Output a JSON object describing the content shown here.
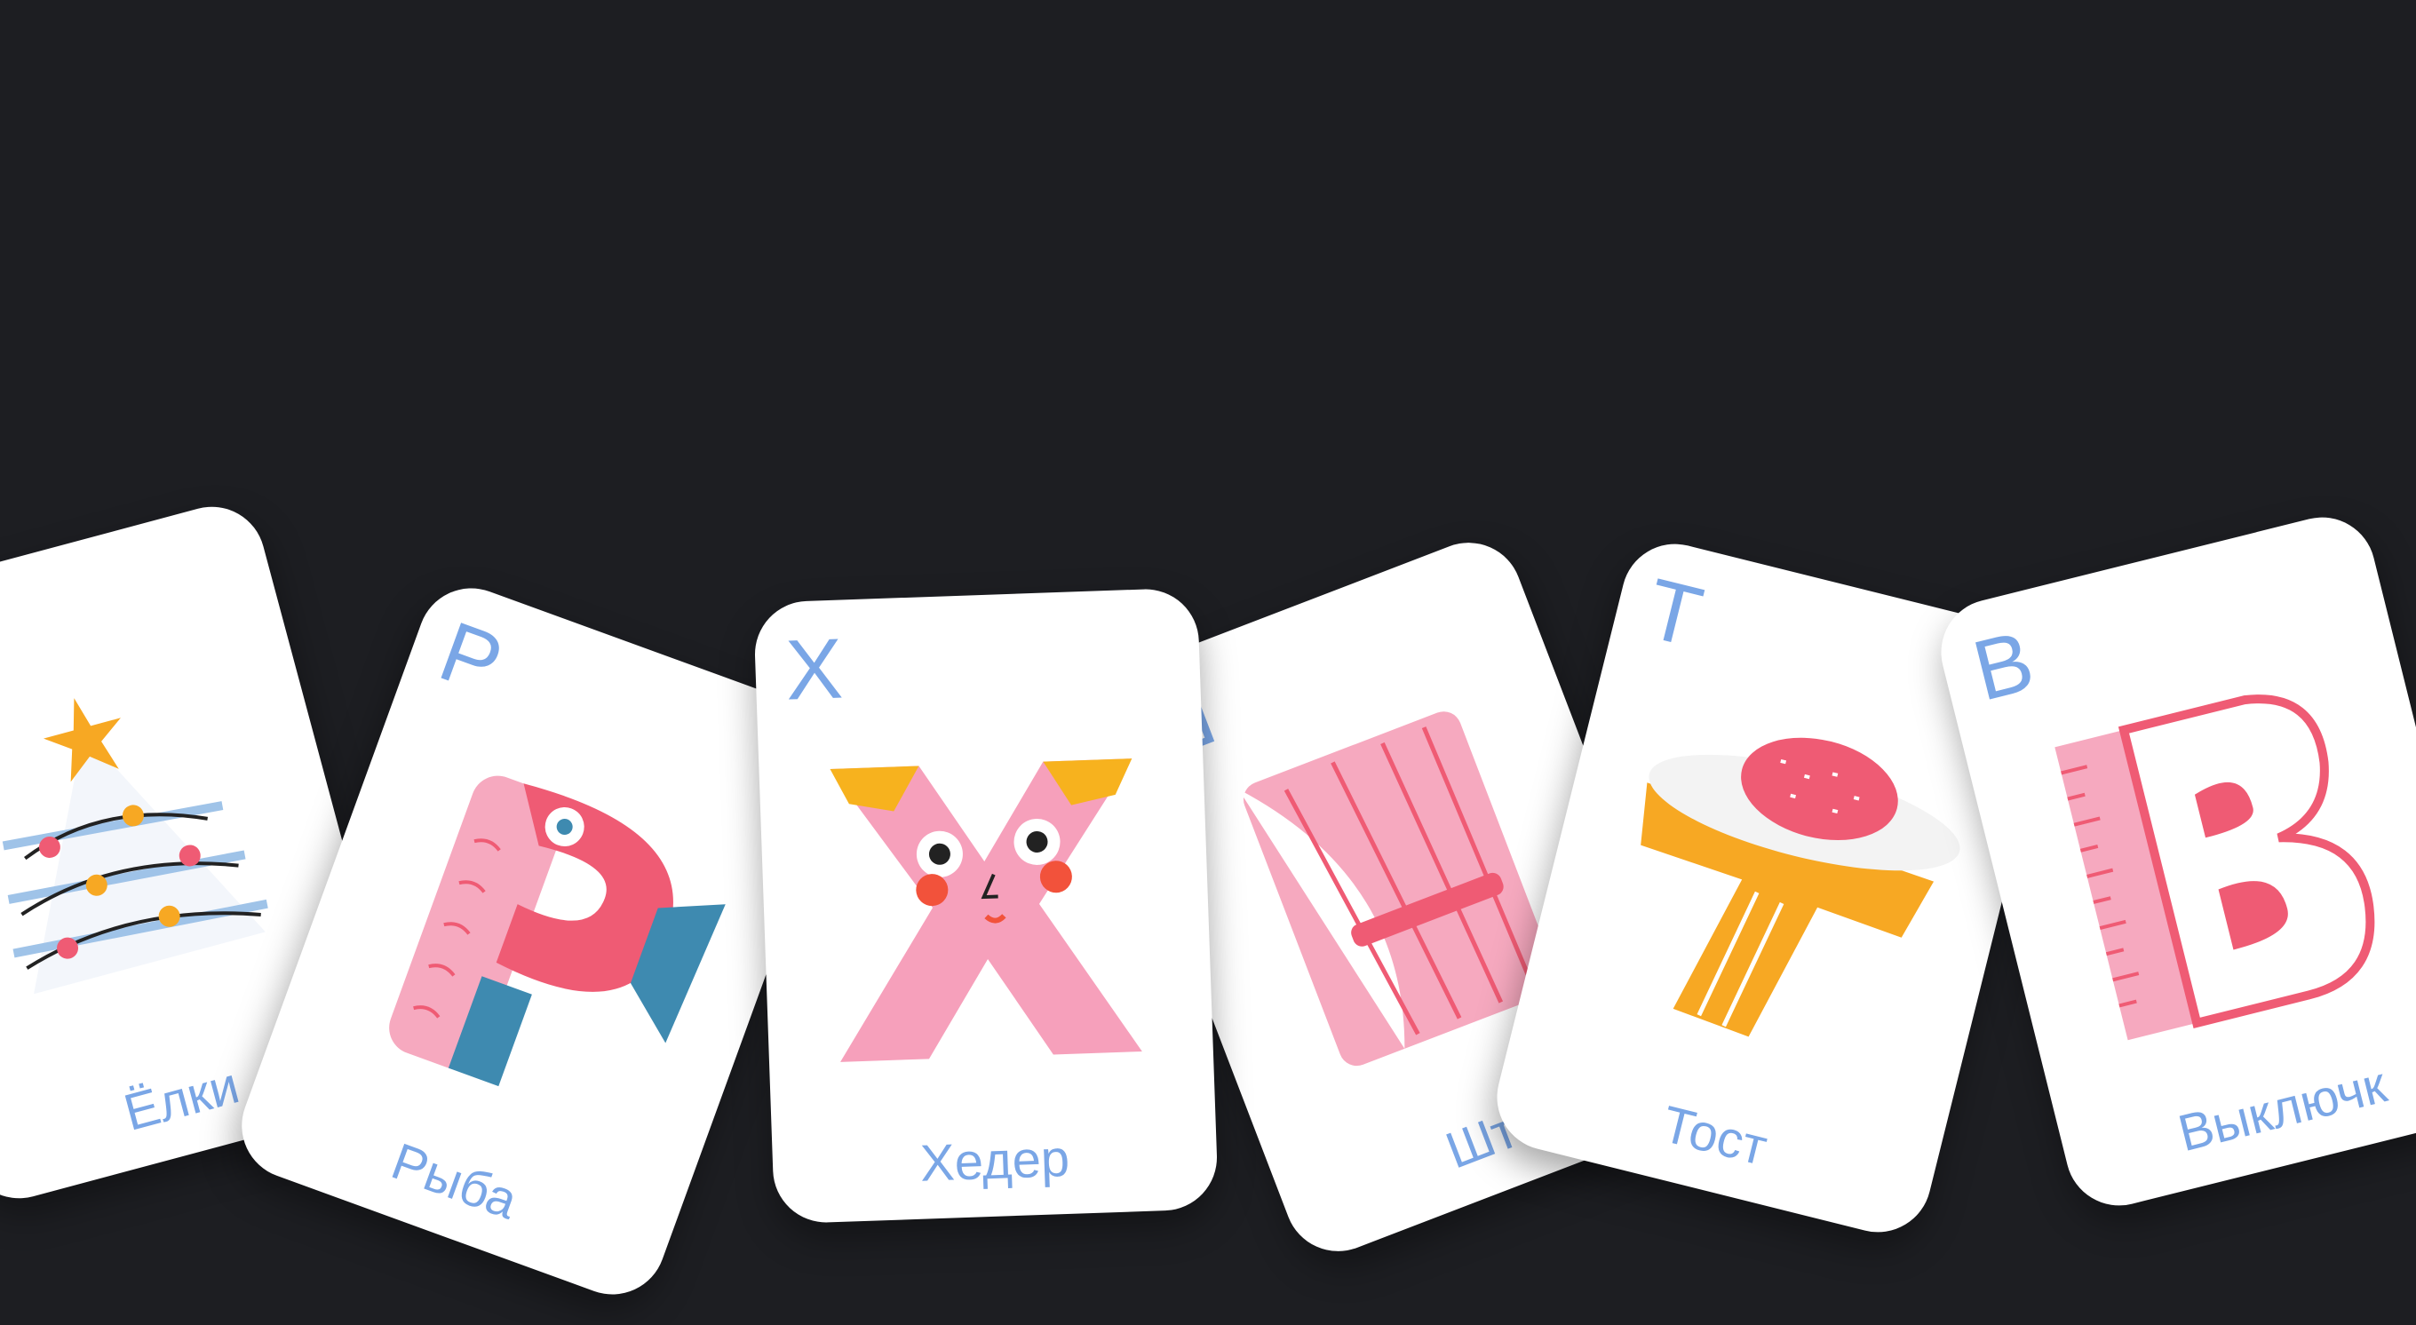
{
  "cards": [
    {
      "letter": "",
      "word": "Ёлки",
      "art_icon": "christmas-tree-icon"
    },
    {
      "letter": "Р",
      "word": "Рыба",
      "art_icon": "fish-letter-r-icon"
    },
    {
      "letter": "Х",
      "word": "Хедер",
      "art_icon": "face-letter-x-icon"
    },
    {
      "letter": "Ш",
      "word": "Што",
      "art_icon": "curtain-icon"
    },
    {
      "letter": "Т",
      "word": "Тост",
      "art_icon": "toast-letter-t-icon"
    },
    {
      "letter": "В",
      "word": "Выключк",
      "art_icon": "ruler-letter-v-icon"
    }
  ],
  "colors": {
    "background": "#1d1e22",
    "card": "#ffffff",
    "accent_text": "#7aa6e6",
    "pink": "#f59ab3",
    "red": "#ef5b74",
    "orange": "#f7a823",
    "blue": "#3e8ab0"
  }
}
